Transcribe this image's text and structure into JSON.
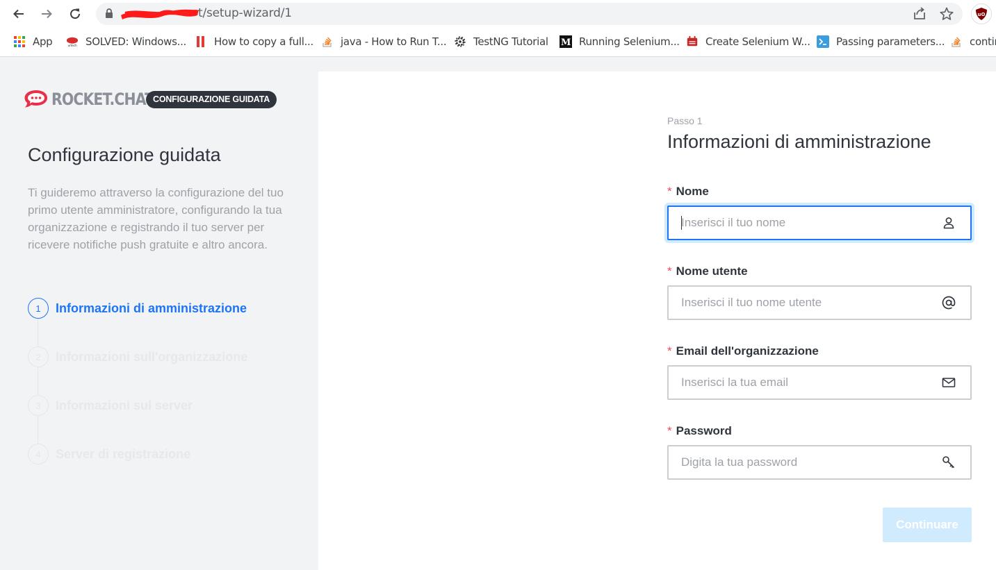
{
  "browser": {
    "url_visible": "t/setup-wizard/1",
    "bookmarks": [
      {
        "label": "App",
        "icon": "apps-grid-icon"
      },
      {
        "label": "SOLVED: Windows...",
        "icon": "urtech-icon"
      },
      {
        "label": "How to copy a full...",
        "icon": "red-bars-icon"
      },
      {
        "label": "java - How to Run T...",
        "icon": "stackoverflow-icon"
      },
      {
        "label": "TestNG Tutorial",
        "icon": "gear-icon"
      },
      {
        "label": "Running Selenium...",
        "icon": "medium-icon"
      },
      {
        "label": "Create Selenium W...",
        "icon": "selenium-icon"
      },
      {
        "label": "Passing parameters...",
        "icon": "docs-icon"
      },
      {
        "label": "contin",
        "icon": "stackoverflow-icon"
      }
    ]
  },
  "sidebar": {
    "logo_text": "ROCKET.CHAT",
    "badge": "CONFIGURAZIONE GUIDATA",
    "title": "Configurazione guidata",
    "description": "Ti guideremo attraverso la configurazione del tuo primo utente amministratore, configurando la tua organizzazione e registrando il tuo server per ricevere notifiche push gratuite e altro ancora.",
    "steps": [
      {
        "number": "1",
        "label": "Informazioni di amministrazione",
        "active": true
      },
      {
        "number": "2",
        "label": "Informazioni sull'organizzazione",
        "active": false
      },
      {
        "number": "3",
        "label": "Informazioni sul server",
        "active": false
      },
      {
        "number": "4",
        "label": "Server di registrazione",
        "active": false
      }
    ]
  },
  "form": {
    "step_caption": "Passo 1",
    "title": "Informazioni di amministrazione",
    "required_mark": "*",
    "fields": [
      {
        "label": "Nome",
        "placeholder": "Inserisci il tuo nome",
        "value": "",
        "icon": "user-icon"
      },
      {
        "label": "Nome utente",
        "placeholder": "Inserisci il tuo nome utente",
        "value": "",
        "icon": "at-icon"
      },
      {
        "label": "Email dell'organizzazione",
        "placeholder": "Inserisci la tua email",
        "value": "",
        "icon": "mail-icon"
      },
      {
        "label": "Password",
        "placeholder": "Digita la tua password",
        "value": "",
        "icon": "key-icon"
      }
    ],
    "continue_label": "Continuare"
  },
  "colors": {
    "accent": "#1d74f5",
    "required": "#f5455c",
    "button_disabled": "#d1ebfe",
    "logo_red": "#e8304a"
  }
}
